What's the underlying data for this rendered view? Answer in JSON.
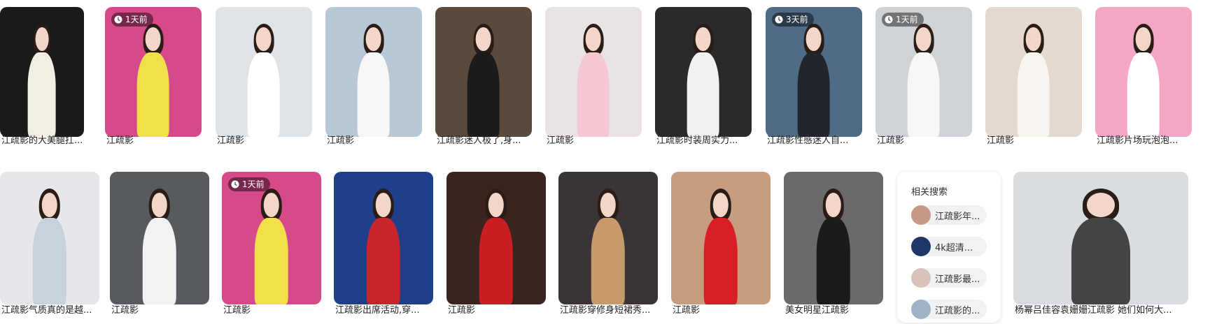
{
  "related_search": {
    "title": "相关搜索",
    "items": [
      {
        "label": "江疏影年...",
        "avatar_color": "#c79a86"
      },
      {
        "label": "4k超清...",
        "avatar_color": "#1e3768"
      },
      {
        "label": "江疏影最...",
        "avatar_color": "#d9c3bb"
      },
      {
        "label": "江疏影的...",
        "avatar_color": "#9fb3c6"
      }
    ]
  },
  "row1": [
    {
      "caption": "江疏影的大美腿扛...",
      "badge": "",
      "bg": "#1a1a1a",
      "outfit": "#f3eee3"
    },
    {
      "caption": "江疏影",
      "badge": "1天前",
      "bg": "#d64a8a",
      "outfit": "#f2e04b"
    },
    {
      "caption": "江疏影",
      "badge": "",
      "bg": "#dfe4e8",
      "outfit": "#ffffff"
    },
    {
      "caption": "江疏影",
      "badge": "",
      "bg": "#b9c8d6",
      "outfit": "#f7f7f7"
    },
    {
      "caption": "江疏影迷人极了,身...",
      "badge": "",
      "bg": "#5b4a3c",
      "outfit": "#1b1b1b"
    },
    {
      "caption": "江疏影",
      "badge": "",
      "bg": "#e9e3e6",
      "outfit": "#f4c7d2"
    },
    {
      "caption": "江疏影时装周实力...",
      "badge": "",
      "bg": "#2a2a2a",
      "outfit": "#f1f1ef"
    },
    {
      "caption": "江疏影性感迷人自...",
      "badge": "3天前",
      "bg": "#4f6b86",
      "outfit": "#22252c"
    },
    {
      "caption": "江疏影",
      "badge": "1天前",
      "bg": "#cfd3d8",
      "outfit": "#f7f7f7"
    },
    {
      "caption": "江疏影",
      "badge": "",
      "bg": "#e4d8cf",
      "outfit": "#f8f4ef"
    },
    {
      "caption": "江疏影片场玩泡泡...",
      "badge": "",
      "bg": "#f3a6c6",
      "outfit": "#ffffff"
    }
  ],
  "row2": [
    {
      "caption": "江疏影气质真的是越...",
      "badge": "",
      "bg": "#e5e7ea",
      "outfit": "#c7d2dd"
    },
    {
      "caption": "江疏影",
      "badge": "",
      "bg": "#575a5e",
      "outfit": "#f2f2f2"
    },
    {
      "caption": "江疏影",
      "badge": "1天前",
      "bg": "#d64a8a",
      "outfit": "#f2e04b"
    },
    {
      "caption": "江疏影出席活动,穿...",
      "badge": "",
      "bg": "#1f3f8a",
      "outfit": "#c5252b"
    },
    {
      "caption": "江疏影",
      "badge": "",
      "bg": "#3b2420",
      "outfit": "#c91e24"
    },
    {
      "caption": "江疏影穿修身短裙秀...",
      "badge": "",
      "bg": "#3b3437",
      "outfit": "#c79a6b"
    },
    {
      "caption": "江疏影",
      "badge": "",
      "bg": "#c79d80",
      "outfit": "#d81f26"
    },
    {
      "caption": "美女明星江疏影",
      "badge": "",
      "bg": "#6a6a6a",
      "outfit": "#1b1b1b"
    },
    {
      "caption": "杨幂吕佳容袁姗姗江疏影 她们如何大...",
      "badge": "",
      "bg": "#d9dde2",
      "outfit": "#444444"
    }
  ]
}
